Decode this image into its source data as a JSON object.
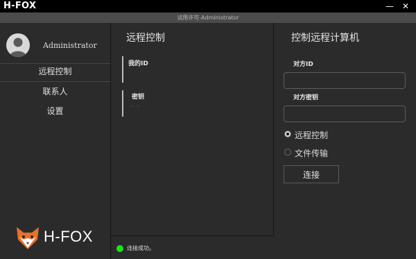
{
  "window": {
    "app_title": "H-FOX",
    "subtitle": "试用许可-Administrator",
    "minimize_glyph": "—",
    "close_glyph": "✕"
  },
  "sidebar": {
    "username": "Administrator",
    "items": [
      {
        "label": "远程控制"
      },
      {
        "label": "联系人"
      },
      {
        "label": "设置"
      }
    ],
    "brand_text": "H-FOX"
  },
  "local_panel": {
    "title": "远程控制",
    "my_id_label": "我的ID",
    "my_id_value": "",
    "password_label": "密钥",
    "password_value": "- -"
  },
  "remote_panel": {
    "title": "控制远程计算机",
    "peer_id_label": "对方ID",
    "peer_id_value": "",
    "peer_password_label": "对方密钥",
    "peer_password_value": "",
    "mode_options": [
      {
        "label": "远程控制",
        "checked": true
      },
      {
        "label": "文件传输",
        "checked": false
      }
    ],
    "connect_label": "连接"
  },
  "status": {
    "text": "连接成功。",
    "color": "#19e619"
  }
}
